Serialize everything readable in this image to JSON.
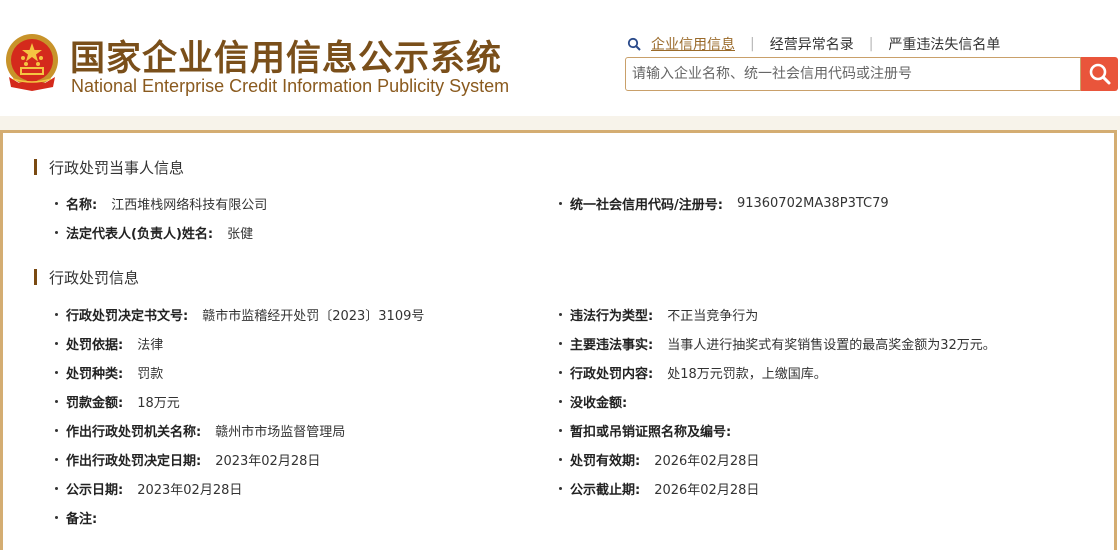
{
  "header": {
    "title_cn": "国家企业信用信息公示系统",
    "title_en": "National Enterprise Credit Information Publicity System",
    "nav": [
      {
        "label": "企业信用信息",
        "active": true
      },
      {
        "label": "经营异常名录",
        "active": false
      },
      {
        "label": "严重违法失信名单",
        "active": false
      }
    ],
    "search": {
      "placeholder": "请输入企业名称、统一社会信用代码或注册号"
    },
    "colors": {
      "brand": "#7a4f1a",
      "accent": "#e9553b",
      "border": "#d4ad72"
    }
  },
  "party_section": {
    "title": "行政处罚当事人信息",
    "name_label": "名称:",
    "name_value": "江西堆栈网络科技有限公司",
    "credit_code_label": "统一社会信用代码/注册号:",
    "credit_code_value": "91360702MA38P3TC79",
    "legal_rep_label": "法定代表人(负责人)姓名:",
    "legal_rep_value": "张健"
  },
  "penalty_section": {
    "title": "行政处罚信息",
    "rows": [
      {
        "left_label": "行政处罚决定书文号:",
        "left_value": "赣市市监稽经开处罚〔2023〕3109号",
        "right_label": "违法行为类型:",
        "right_value": "不正当竞争行为"
      },
      {
        "left_label": "处罚依据:",
        "left_value": "法律",
        "right_label": "主要违法事实:",
        "right_value": "当事人进行抽奖式有奖销售设置的最高奖金额为32万元。"
      },
      {
        "left_label": "处罚种类:",
        "left_value": "罚款",
        "right_label": "行政处罚内容:",
        "right_value": "处18万元罚款，上缴国库。"
      },
      {
        "left_label": "罚款金额:",
        "left_value": "18万元",
        "right_label": "没收金额:",
        "right_value": ""
      },
      {
        "left_label": "作出行政处罚机关名称:",
        "left_value": "赣州市市场监督管理局",
        "right_label": "暂扣或吊销证照名称及编号:",
        "right_value": ""
      },
      {
        "left_label": "作出行政处罚决定日期:",
        "left_value": "2023年02月28日",
        "right_label": "处罚有效期:",
        "right_value": "2026年02月28日"
      },
      {
        "left_label": "公示日期:",
        "left_value": "2023年02月28日",
        "right_label": "公示截止期:",
        "right_value": "2026年02月28日"
      }
    ],
    "remark_label": "备注:"
  }
}
